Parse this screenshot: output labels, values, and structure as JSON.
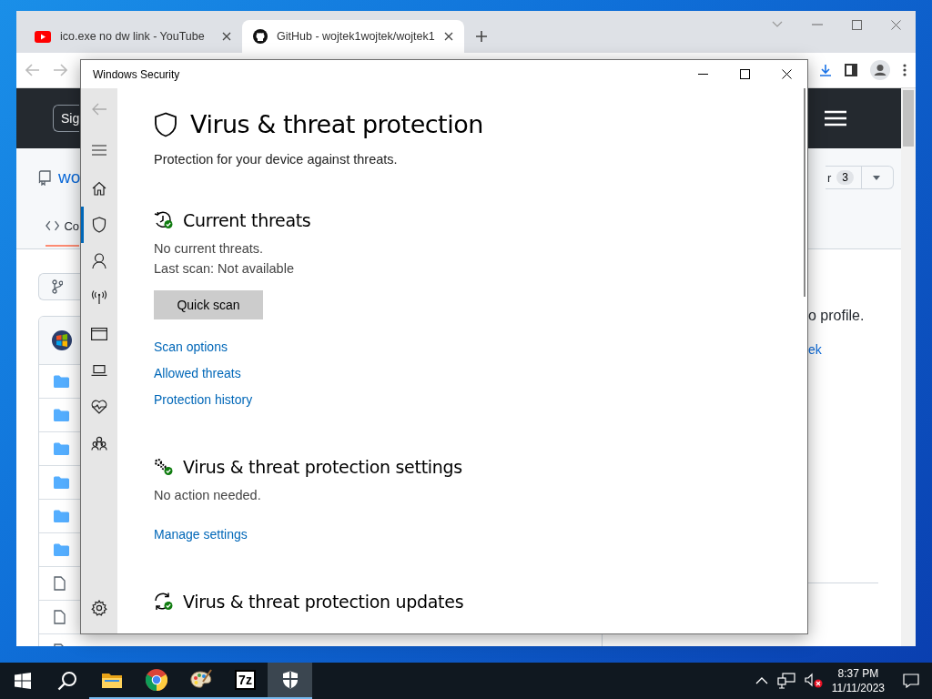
{
  "browser": {
    "tabs": [
      {
        "kind": "youtube",
        "title": "ico.exe no dw link - YouTube",
        "selected": false
      },
      {
        "kind": "github",
        "title": "GitHub - wojtek1wojtek/wojtek1",
        "selected": true
      }
    ],
    "page": {
      "sign_button": "Sig",
      "repo_name": "wo",
      "code_tab": "Co",
      "branch_count_label": "r",
      "branch_count": "3",
      "profile_text": "o profile.",
      "profile_link": "ek",
      "files": [
        {
          "kind": "avatar"
        },
        {
          "kind": "folder"
        },
        {
          "kind": "folder"
        },
        {
          "kind": "folder"
        },
        {
          "kind": "folder"
        },
        {
          "kind": "folder"
        },
        {
          "kind": "folder"
        },
        {
          "kind": "file"
        },
        {
          "kind": "file"
        },
        {
          "kind": "file"
        }
      ]
    }
  },
  "security": {
    "title": "Windows Security",
    "nav": [
      {
        "kind": "home",
        "selected": false
      },
      {
        "kind": "shield",
        "selected": true
      },
      {
        "kind": "account",
        "selected": false
      },
      {
        "kind": "network",
        "selected": false
      },
      {
        "kind": "app",
        "selected": false
      },
      {
        "kind": "device",
        "selected": false
      },
      {
        "kind": "health",
        "selected": false
      },
      {
        "kind": "family",
        "selected": false
      }
    ],
    "heading": "Virus & threat protection",
    "subtitle": "Protection for your device against threats.",
    "sections": [
      {
        "kind": "threats",
        "title": "Current threats",
        "lines": [
          "No current threats.",
          "Last scan: Not available"
        ],
        "button": "Quick scan",
        "links": [
          "Scan options",
          "Allowed threats",
          "Protection history"
        ]
      },
      {
        "kind": "settings",
        "title": "Virus & threat protection settings",
        "lines": [
          "No action needed."
        ],
        "links": [
          "Manage settings"
        ]
      },
      {
        "kind": "updates",
        "title": "Virus & threat protection updates"
      }
    ]
  },
  "taskbar": {
    "apps": [
      {
        "kind": "start",
        "running": false,
        "active": false
      },
      {
        "kind": "search",
        "running": false,
        "active": false
      },
      {
        "kind": "explorer",
        "running": true,
        "active": false
      },
      {
        "kind": "chrome",
        "running": true,
        "active": false
      },
      {
        "kind": "paint",
        "running": true,
        "active": false
      },
      {
        "kind": "zip",
        "label": "7z",
        "running": true,
        "active": false
      },
      {
        "kind": "defender",
        "running": true,
        "active": true
      }
    ],
    "time": "8:37 PM",
    "date": "11/11/2023"
  }
}
